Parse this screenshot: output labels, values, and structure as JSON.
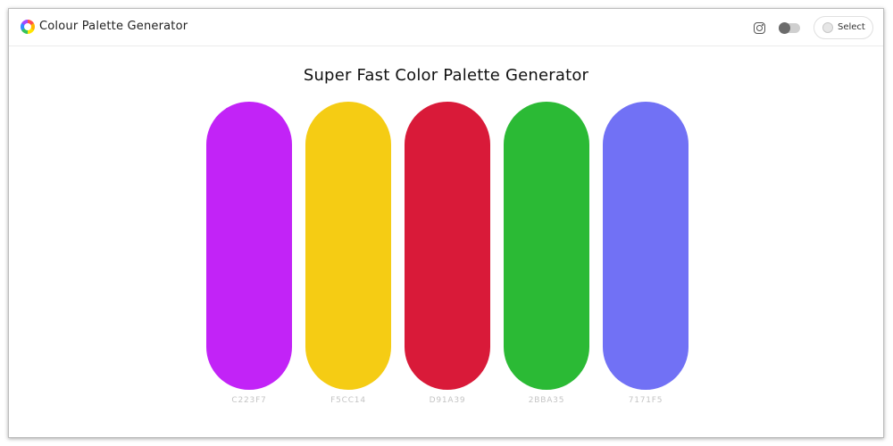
{
  "header": {
    "app_title": "Colour Palette Generator",
    "logo_icon": "color-wheel-icon",
    "instagram_icon": "instagram-icon",
    "theme_toggle": {
      "state": "off"
    },
    "select_button": {
      "label": "Select",
      "icon": "circle-icon"
    }
  },
  "main": {
    "title": "Super Fast Color Palette Generator",
    "swatches": [
      {
        "hex_label": "C223F7",
        "color": "#C223F7"
      },
      {
        "hex_label": "F5CC14",
        "color": "#F5CC14"
      },
      {
        "hex_label": "D91A39",
        "color": "#D91A39"
      },
      {
        "hex_label": "2BBA35",
        "color": "#2BBA35"
      },
      {
        "hex_label": "7171F5",
        "color": "#7171F5"
      }
    ]
  }
}
